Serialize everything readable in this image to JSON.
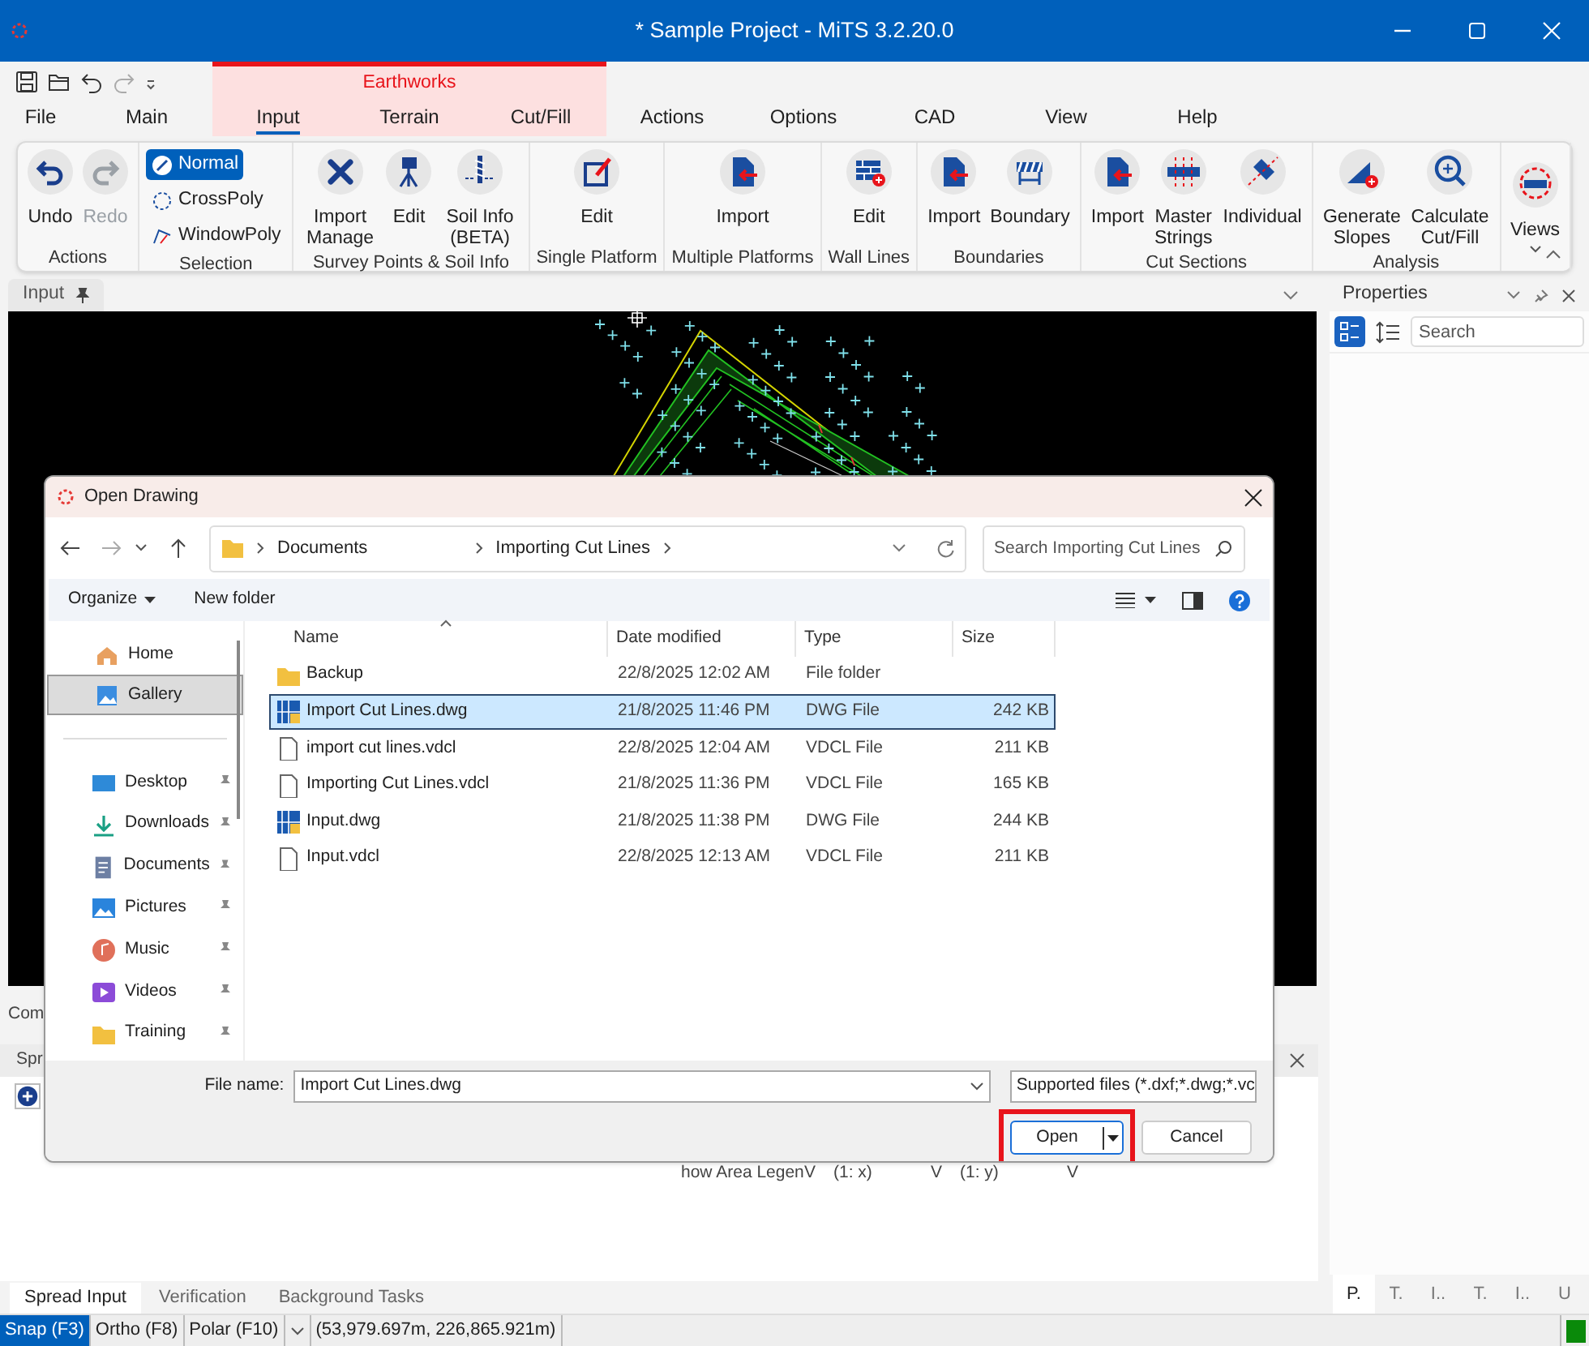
{
  "window": {
    "title": "* Sample Project - MiTS 3.2.20.0"
  },
  "contextual_group": {
    "label": "Earthworks"
  },
  "ribbon_tabs": [
    {
      "label": "File",
      "selected": false,
      "contextual": false
    },
    {
      "label": "Main",
      "selected": false,
      "contextual": false
    },
    {
      "label": "Input",
      "selected": true,
      "contextual": true
    },
    {
      "label": "Terrain",
      "selected": false,
      "contextual": true
    },
    {
      "label": "Cut/Fill",
      "selected": false,
      "contextual": true
    },
    {
      "label": "Actions",
      "selected": false,
      "contextual": false
    },
    {
      "label": "Options",
      "selected": false,
      "contextual": false
    },
    {
      "label": "CAD",
      "selected": false,
      "contextual": false
    },
    {
      "label": "View",
      "selected": false,
      "contextual": false
    },
    {
      "label": "Help",
      "selected": false,
      "contextual": false
    }
  ],
  "ribbon_groups": [
    {
      "label": "Actions",
      "items": [
        {
          "kind": "large",
          "label": "Undo",
          "disabled": false
        },
        {
          "kind": "large",
          "label": "Redo",
          "disabled": true
        }
      ]
    },
    {
      "label": "Selection",
      "items": [
        {
          "kind": "option",
          "label": "Normal",
          "selected": true
        },
        {
          "kind": "option",
          "label": "CrossPoly",
          "selected": false
        },
        {
          "kind": "option",
          "label": "WindowPoly",
          "selected": false
        }
      ]
    },
    {
      "label": "Survey Points & Soil Info",
      "items": [
        {
          "kind": "large",
          "label": "Import Manage",
          "disabled": false
        },
        {
          "kind": "large",
          "label": "Edit",
          "disabled": false
        },
        {
          "kind": "large",
          "label": "Soil Info (BETA)",
          "disabled": false
        }
      ]
    },
    {
      "label": "Single Platform",
      "items": [
        {
          "kind": "large",
          "label": "Edit",
          "disabled": false
        }
      ]
    },
    {
      "label": "Multiple Platforms",
      "items": [
        {
          "kind": "large",
          "label": "Import",
          "disabled": false
        }
      ]
    },
    {
      "label": "Wall Lines",
      "items": [
        {
          "kind": "large",
          "label": "Edit",
          "disabled": false
        }
      ]
    },
    {
      "label": "Boundaries",
      "items": [
        {
          "kind": "large",
          "label": "Import",
          "disabled": false
        },
        {
          "kind": "large",
          "label": "Boundary",
          "disabled": false
        }
      ]
    },
    {
      "label": "Cut Sections",
      "items": [
        {
          "kind": "large",
          "label": "Import",
          "disabled": false
        },
        {
          "kind": "large",
          "label": "Master Strings",
          "disabled": false
        },
        {
          "kind": "large",
          "label": "Individual",
          "disabled": false
        }
      ]
    },
    {
      "label": "Analysis",
      "items": [
        {
          "kind": "large",
          "label": "Generate Slopes",
          "disabled": false
        },
        {
          "kind": "large",
          "label": "Calculate Cut/Fill",
          "disabled": false
        }
      ]
    },
    {
      "items": [
        {
          "kind": "dropdown",
          "label": "Views",
          "disabled": false
        }
      ]
    }
  ],
  "document_tab": {
    "label": "Input"
  },
  "background_panel": {
    "command_label": "Com",
    "spread_title": "Spr",
    "grid_cells": [
      "how Area Legen",
      "V",
      "(1: x)",
      "V",
      "(1: y)",
      "V"
    ]
  },
  "bottom_tabs": [
    {
      "label": "Spread Input",
      "selected": true
    },
    {
      "label": "Verification",
      "selected": false
    },
    {
      "label": "Background Tasks",
      "selected": false
    }
  ],
  "status_bar": {
    "toggles": [
      {
        "label": "Snap (F3)",
        "on": true
      },
      {
        "label": "Ortho (F8)",
        "on": false
      },
      {
        "label": "Polar (F10)",
        "on": false
      }
    ],
    "coordinates": "(53,979.697m, 226,865.921m)"
  },
  "properties_panel": {
    "title": "Properties",
    "search_placeholder": "Search",
    "tabs": [
      {
        "label": "P.",
        "selected": true
      },
      {
        "label": "T.",
        "selected": false
      },
      {
        "label": "I..",
        "selected": false
      },
      {
        "label": "T.",
        "selected": false
      },
      {
        "label": "I..",
        "selected": false
      },
      {
        "label": "U",
        "selected": false
      }
    ]
  },
  "dialog": {
    "title": "Open Drawing",
    "path": [
      "Documents",
      "Importing Cut Lines"
    ],
    "search_placeholder": "Search Importing Cut Lines",
    "organize": "Organize",
    "new_folder": "New folder",
    "nav_top": [
      {
        "label": "Home",
        "selected": false,
        "pinned": false
      },
      {
        "label": "Gallery",
        "selected": true,
        "pinned": false
      }
    ],
    "nav_quick": [
      {
        "label": "Desktop",
        "selected": false,
        "pinned": true
      },
      {
        "label": "Downloads",
        "selected": false,
        "pinned": true
      },
      {
        "label": "Documents",
        "selected": false,
        "pinned": true
      },
      {
        "label": "Pictures",
        "selected": false,
        "pinned": true
      },
      {
        "label": "Music",
        "selected": false,
        "pinned": true
      },
      {
        "label": "Videos",
        "selected": false,
        "pinned": true
      },
      {
        "label": "Training",
        "selected": false,
        "pinned": true
      }
    ],
    "columns": [
      "Name",
      "Date modified",
      "Type",
      "Size"
    ],
    "files": [
      {
        "name": "Backup",
        "date": "22/8/2025 12:02 AM",
        "type": "File folder",
        "kind": "folder",
        "selected": false
      },
      {
        "name": "Import Cut Lines.dwg",
        "date": "21/8/2025 11:46 PM",
        "type": "DWG File",
        "size": "242 KB",
        "kind": "dwg",
        "selected": true
      },
      {
        "name": "import cut lines.vdcl",
        "date": "22/8/2025 12:04 AM",
        "type": "VDCL File",
        "size": "211 KB",
        "kind": "file",
        "selected": false
      },
      {
        "name": "Importing Cut Lines.vdcl",
        "date": "21/8/2025 11:36 PM",
        "type": "VDCL File",
        "size": "165 KB",
        "kind": "file",
        "selected": false
      },
      {
        "name": "Input.dwg",
        "date": "21/8/2025 11:38 PM",
        "type": "DWG File",
        "size": "244 KB",
        "kind": "dwg",
        "selected": false
      },
      {
        "name": "Input.vdcl",
        "date": "22/8/2025 12:13 AM",
        "type": "VDCL File",
        "size": "211 KB",
        "kind": "file",
        "selected": false
      }
    ],
    "file_name_label": "File name:",
    "file_name": "Import Cut Lines.dwg",
    "file_type": "Supported files (*.dxf;*.dwg;*.vc",
    "open_button": {
      "label": "Open",
      "highlighted": true
    },
    "cancel_button": {
      "label": "Cancel"
    }
  }
}
